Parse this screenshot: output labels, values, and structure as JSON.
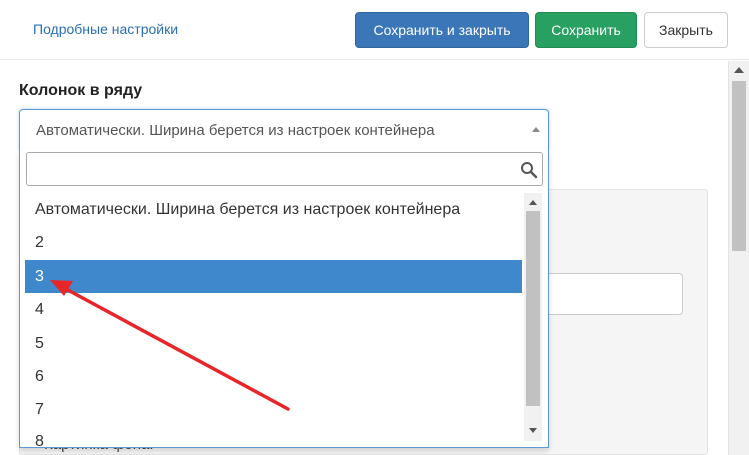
{
  "toolbar": {
    "advanced_link": "Подробные настройки",
    "save_close_label": "Сохранить и закрыть",
    "save_label": "Сохранить",
    "close_label": "Закрыть"
  },
  "field": {
    "label": "Колонок в ряду",
    "selected_value": "Автоматически. Ширина берется из настроек контейнера"
  },
  "dropdown": {
    "search_value": "",
    "options": [
      "Автоматически. Ширина берется из настроек контейнера",
      "2",
      "3",
      "4",
      "5",
      "6",
      "7",
      "8"
    ],
    "highlighted_option": "3"
  },
  "background_section": {
    "partial_label": "Картинка фона:"
  },
  "colors": {
    "primary_button": "#3a76b8",
    "success_button": "#27a062",
    "highlight": "#3e88cb",
    "annotation_arrow": "#e8262a"
  },
  "annotation": {
    "type": "arrow",
    "points_to_option": "3"
  }
}
